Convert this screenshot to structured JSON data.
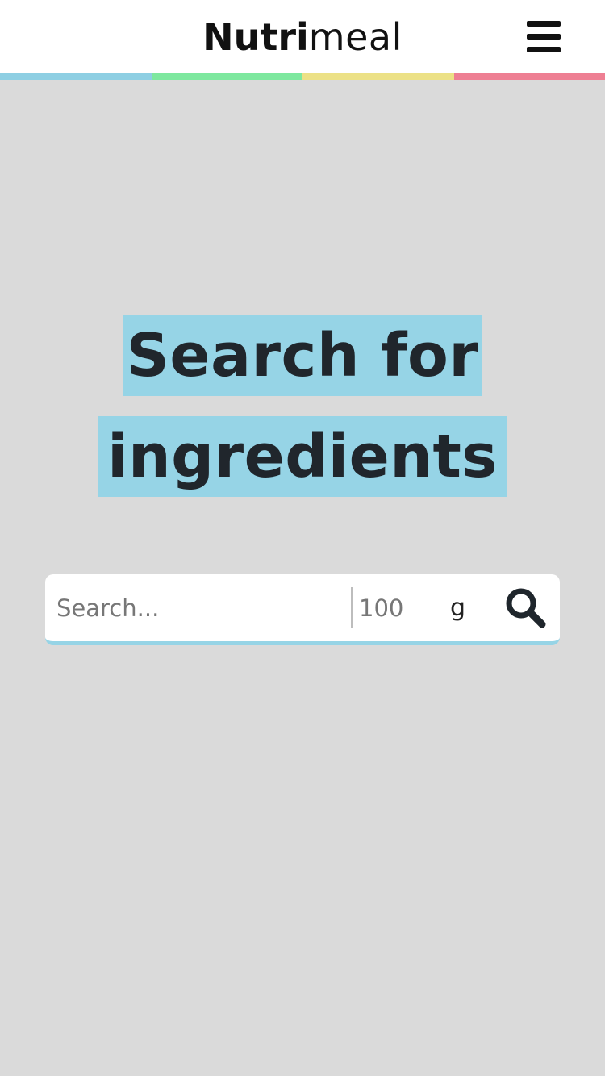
{
  "header": {
    "brand_bold": "Nutri",
    "brand_light": "meal",
    "menu_icon": "hamburger-menu-icon",
    "stripe_colors": [
      "#8ecfe3",
      "#7ee89f",
      "#ece186",
      "#ee7f93"
    ]
  },
  "hero": {
    "line1": "Search for",
    "line2": "ingredients",
    "highlight_color": "#96d4e6"
  },
  "search": {
    "placeholder": "Search...",
    "quantity_placeholder": "100",
    "unit": "g",
    "button_icon": "search-icon"
  }
}
